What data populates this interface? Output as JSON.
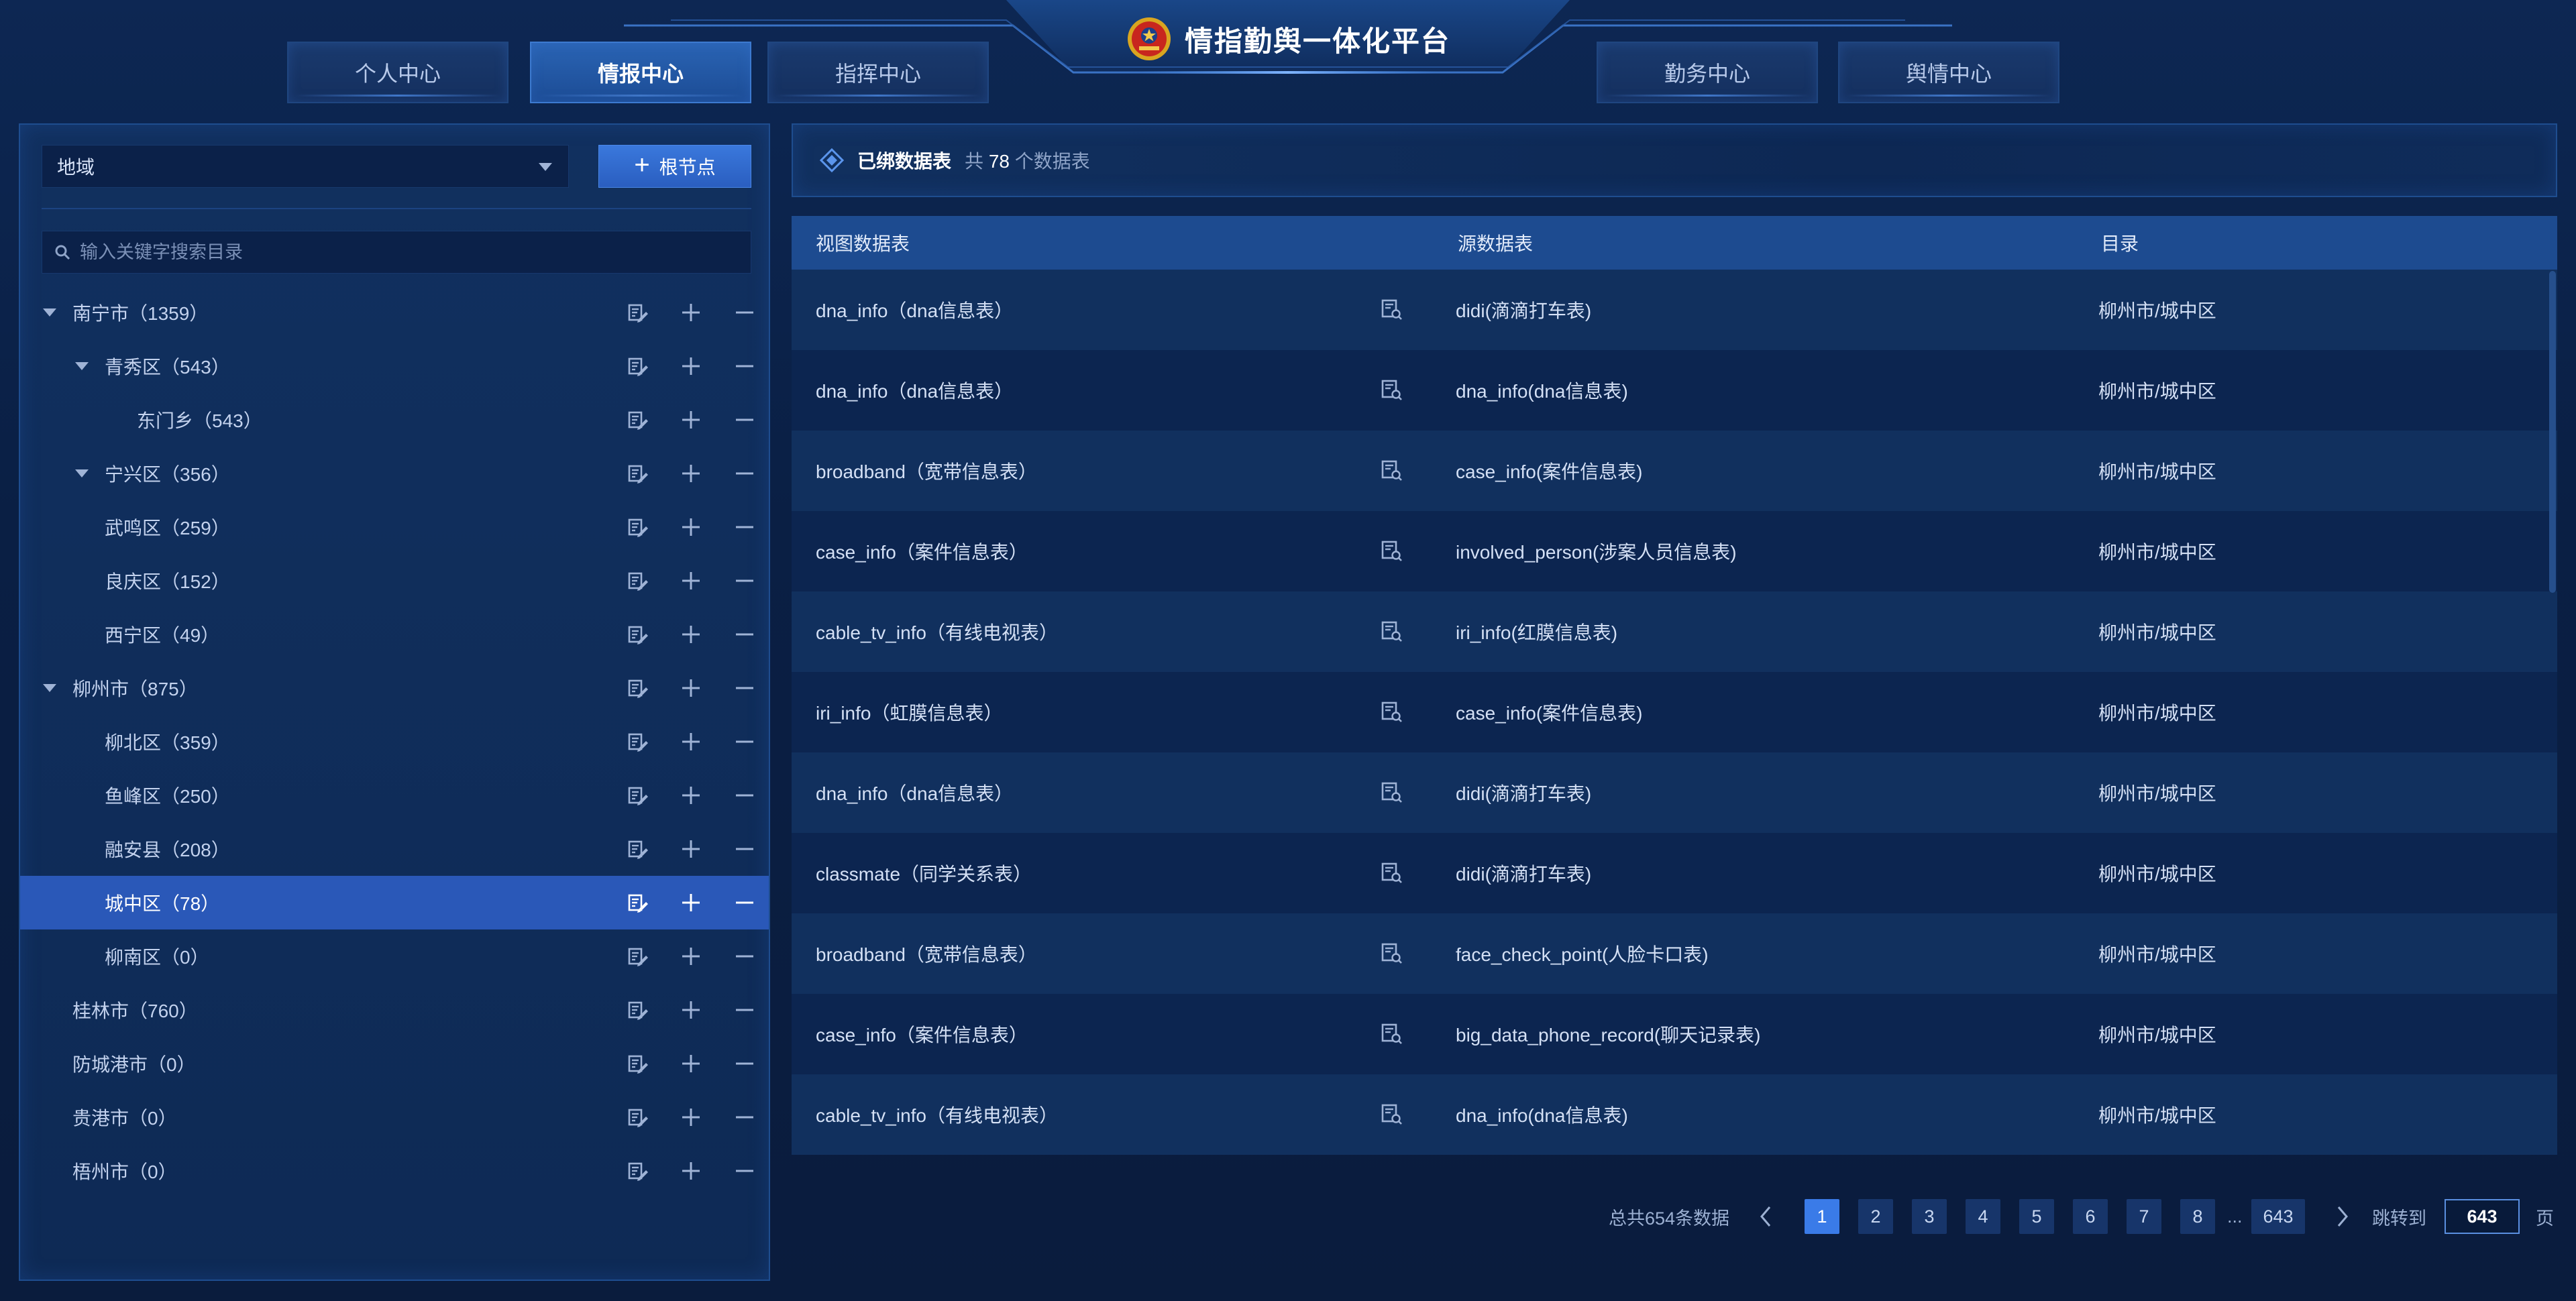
{
  "header": {
    "title": "情指勤舆一体化平台",
    "tabs": [
      {
        "label": "个人中心",
        "active": false
      },
      {
        "label": "情报中心",
        "active": true
      },
      {
        "label": "指挥中心",
        "active": false
      },
      {
        "label": "勤务中心",
        "active": false
      },
      {
        "label": "舆情中心",
        "active": false
      }
    ],
    "emblem_icon": "police-emblem-icon"
  },
  "sidebar": {
    "region_select_value": "地域",
    "root_button_label": "根节点",
    "search_placeholder": "输入关键字搜索目录",
    "tree": [
      {
        "label": "南宁市（1359）",
        "level": 0,
        "expanded": true,
        "selected": false
      },
      {
        "label": "青秀区（543）",
        "level": 1,
        "expanded": true,
        "selected": false
      },
      {
        "label": "东门乡（543）",
        "level": 2,
        "expanded": false,
        "selected": false
      },
      {
        "label": "宁兴区（356）",
        "level": 1,
        "expanded": true,
        "selected": false
      },
      {
        "label": "武鸣区（259）",
        "level": 1,
        "expanded": false,
        "selected": false
      },
      {
        "label": "良庆区（152）",
        "level": 1,
        "expanded": false,
        "selected": false
      },
      {
        "label": "西宁区（49）",
        "level": 1,
        "expanded": false,
        "selected": false
      },
      {
        "label": "柳州市（875）",
        "level": 0,
        "expanded": true,
        "selected": false
      },
      {
        "label": "柳北区（359）",
        "level": 1,
        "expanded": false,
        "selected": false
      },
      {
        "label": "鱼峰区（250）",
        "level": 1,
        "expanded": false,
        "selected": false
      },
      {
        "label": "融安县（208）",
        "level": 1,
        "expanded": false,
        "selected": false
      },
      {
        "label": "城中区（78）",
        "level": 1,
        "expanded": false,
        "selected": true
      },
      {
        "label": "柳南区（0）",
        "level": 1,
        "expanded": false,
        "selected": false
      },
      {
        "label": "桂林市（760）",
        "level": 0,
        "expanded": false,
        "selected": false
      },
      {
        "label": "防城港市（0）",
        "level": 0,
        "expanded": false,
        "selected": false
      },
      {
        "label": "贵港市（0）",
        "level": 0,
        "expanded": false,
        "selected": false
      },
      {
        "label": "梧州市（0）",
        "level": 0,
        "expanded": false,
        "selected": false
      }
    ]
  },
  "bound": {
    "title": "已绑数据表",
    "count_prefix": "共",
    "count": "78",
    "count_suffix": "个数据表"
  },
  "table": {
    "columns": [
      "视图数据表",
      "源数据表",
      "目录"
    ],
    "rows": [
      {
        "view": "dna_info（dna信息表）",
        "source": "didi(滴滴打车表)",
        "dir": "柳州市/城中区"
      },
      {
        "view": "dna_info（dna信息表）",
        "source": "dna_info(dna信息表)",
        "dir": "柳州市/城中区"
      },
      {
        "view": "broadband（宽带信息表）",
        "source": "case_info(案件信息表)",
        "dir": "柳州市/城中区"
      },
      {
        "view": "case_info（案件信息表）",
        "source": "involved_person(涉案人员信息表)",
        "dir": "柳州市/城中区"
      },
      {
        "view": "cable_tv_info（有线电视表）",
        "source": "iri_info(红膜信息表)",
        "dir": "柳州市/城中区"
      },
      {
        "view": "iri_info（虹膜信息表）",
        "source": "case_info(案件信息表)",
        "dir": "柳州市/城中区"
      },
      {
        "view": "dna_info（dna信息表）",
        "source": "didi(滴滴打车表)",
        "dir": "柳州市/城中区"
      },
      {
        "view": "classmate（同学关系表）",
        "source": "didi(滴滴打车表)",
        "dir": "柳州市/城中区"
      },
      {
        "view": "broadband（宽带信息表）",
        "source": "face_check_point(人脸卡口表)",
        "dir": "柳州市/城中区"
      },
      {
        "view": "case_info（案件信息表）",
        "source": "big_data_phone_record(聊天记录表)",
        "dir": "柳州市/城中区"
      },
      {
        "view": "cable_tv_info（有线电视表）",
        "source": "dna_info(dna信息表)",
        "dir": "柳州市/城中区"
      }
    ]
  },
  "pagination": {
    "total_text": "总共654条数据",
    "pages": [
      "1",
      "2",
      "3",
      "4",
      "5",
      "6",
      "7",
      "8"
    ],
    "ellipsis": "...",
    "last_page": "643",
    "current_page": "1",
    "jump_label": "跳转到",
    "jump_value": "643",
    "page_unit": "页"
  },
  "colors": {
    "background": "#0b2045",
    "accent": "#3a7be8",
    "selected_row": "#2a58b8",
    "table_header": "#1d4b90"
  }
}
